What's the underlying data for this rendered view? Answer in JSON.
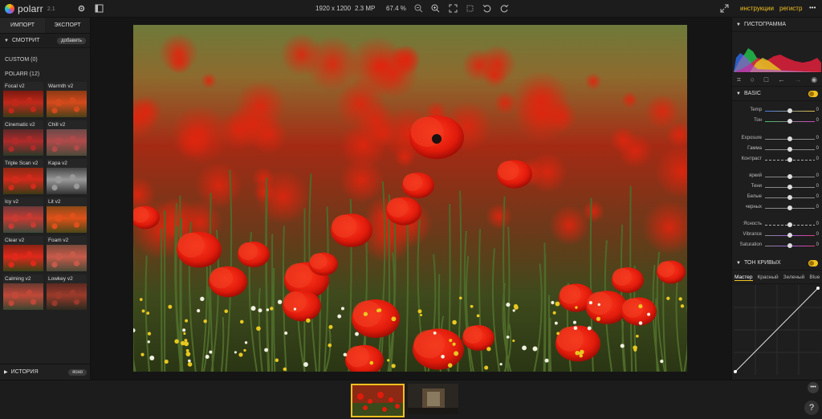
{
  "app": {
    "name": "polarr",
    "version": "2.1"
  },
  "topbar": {
    "resolution": "1920 x 1200",
    "megapixels": "2.3 MP",
    "zoom": "67.4 %",
    "link_instructions": "инструкции",
    "link_register": "регистр",
    "more": "•••"
  },
  "left": {
    "tab_import": "ИМПОРТ",
    "tab_export": "ЭКСПОРТ",
    "section_view": "СМОТРИТ",
    "add_button": "добавить",
    "group_custom": "CUSTOM (0)",
    "group_polarr": "POLARR (12)",
    "filters": [
      {
        "label": "Focal v2"
      },
      {
        "label": "Warmth v2"
      },
      {
        "label": "Cinematic v2"
      },
      {
        "label": "Chill v2"
      },
      {
        "label": "Triple Scan v2"
      },
      {
        "label": "Kapa v2"
      },
      {
        "label": "Icy v2"
      },
      {
        "label": "Lit v2"
      },
      {
        "label": "Clear v2"
      },
      {
        "label": "Foam v2"
      },
      {
        "label": "Calming v2"
      },
      {
        "label": "Lowkey v2"
      }
    ],
    "history_label": "ИСТОРИЯ",
    "history_button": "ясно"
  },
  "right": {
    "histogram_label": "ГИСТОГРАММА",
    "basic_label": "BASIC",
    "sliders": [
      {
        "label": "Temp",
        "value": "0",
        "pos": 0.5,
        "track": "blue-yellow"
      },
      {
        "label": "Тон",
        "value": "0",
        "pos": 0.5,
        "track": "green-magenta"
      },
      {
        "label": "Exposure",
        "value": "0",
        "pos": 0.5,
        "track": "plain"
      },
      {
        "label": "Гамма",
        "value": "0",
        "pos": 0.5,
        "track": "plain"
      },
      {
        "label": "Контраст",
        "value": "0",
        "pos": 0.5,
        "track": "dashed"
      },
      {
        "label": "яркий",
        "value": "0",
        "pos": 0.5,
        "track": "plain"
      },
      {
        "label": "Тени",
        "value": "0",
        "pos": 0.5,
        "track": "plain"
      },
      {
        "label": "Белые",
        "value": "0",
        "pos": 0.5,
        "track": "plain"
      },
      {
        "label": "черных",
        "value": "0",
        "pos": 0.5,
        "track": "plain"
      },
      {
        "label": "Ясность",
        "value": "0",
        "pos": 0.5,
        "track": "dashed"
      },
      {
        "label": "Vibrance",
        "value": "0",
        "pos": 0.5,
        "track": "colorful"
      },
      {
        "label": "Saturation",
        "value": "0",
        "pos": 0.5,
        "track": "colorful"
      }
    ],
    "curves_label": "ТОН КРИВЫХ",
    "curve_tabs": [
      "Мастер",
      "Красный",
      "Зеленый",
      "Blue"
    ]
  },
  "corner": {
    "help": "?",
    "more": "•••"
  }
}
